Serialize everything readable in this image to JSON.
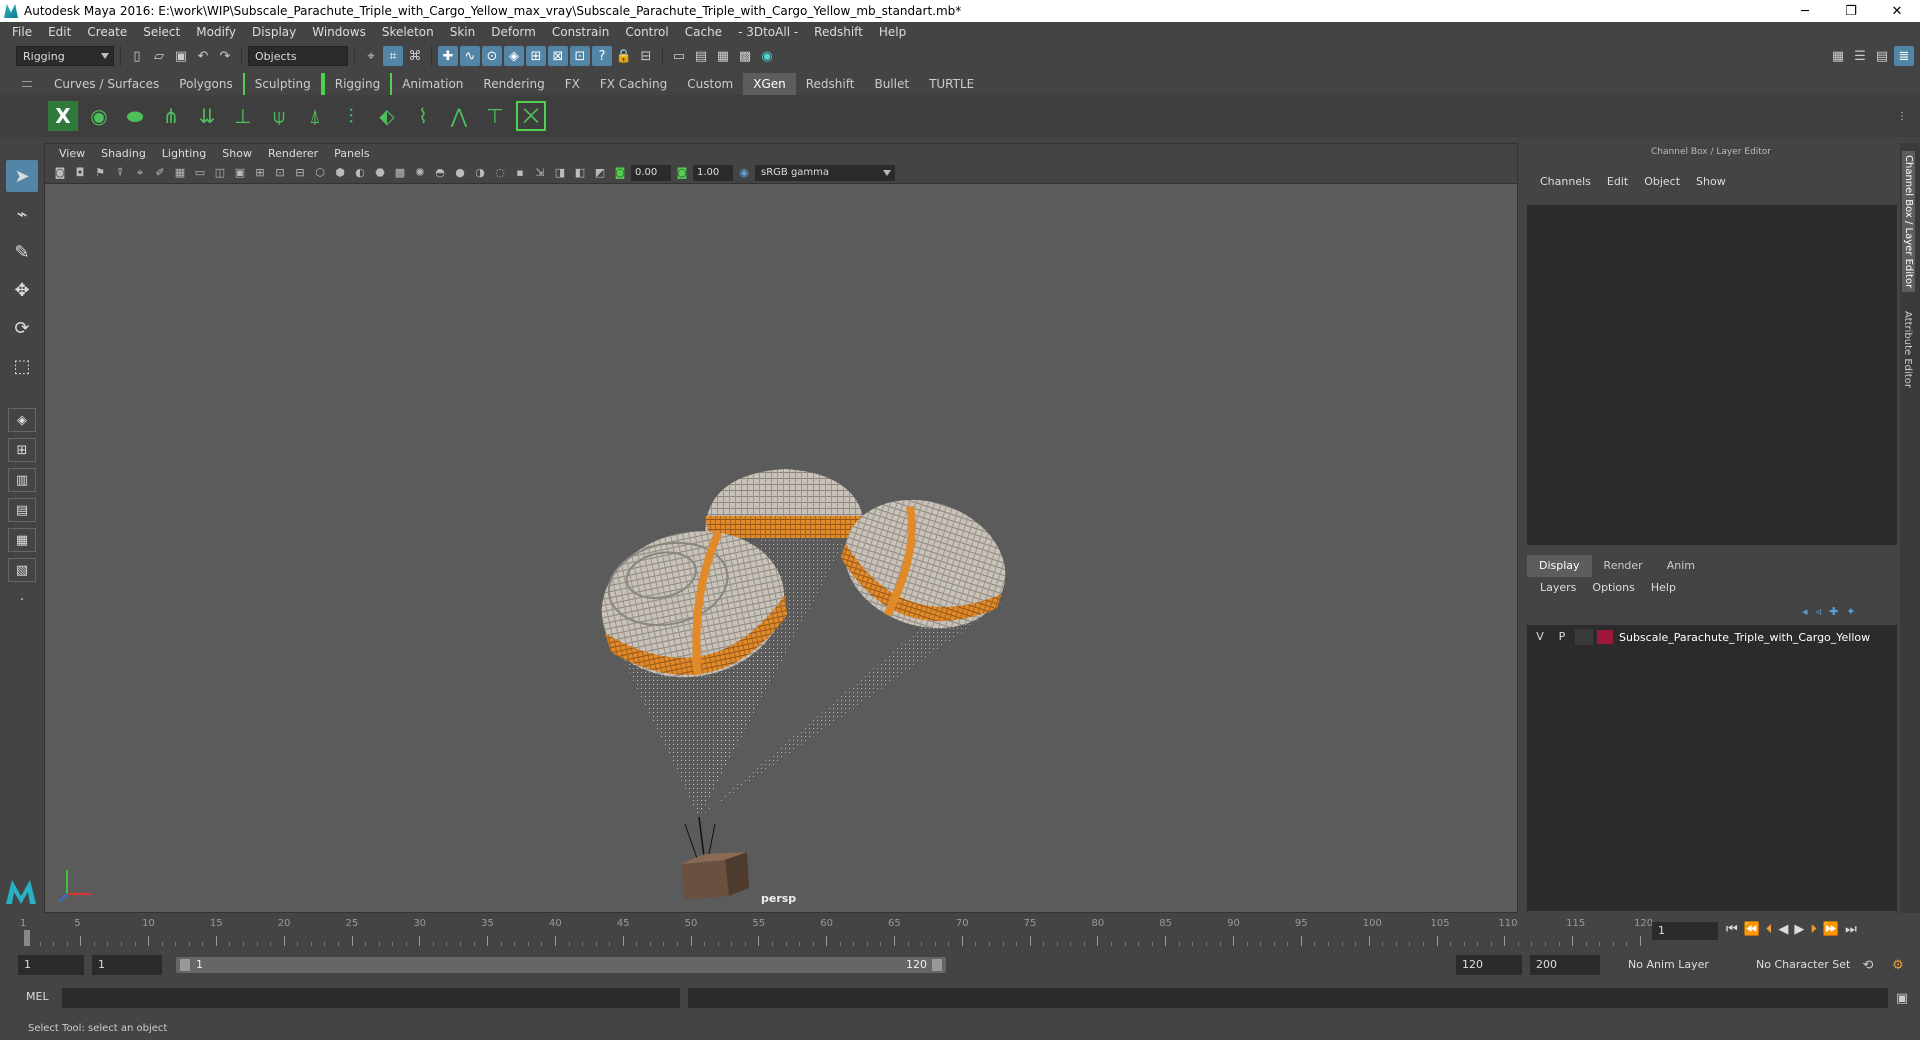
{
  "window": {
    "title": "Autodesk Maya 2016: E:\\work\\WIP\\Subscale_Parachute_Triple_with_Cargo_Yellow_max_vray\\Subscale_Parachute_Triple_with_Cargo_Yellow_mb_standart.mb*",
    "minimize": "─",
    "restore": "❐",
    "close": "✕"
  },
  "menubar": [
    "File",
    "Edit",
    "Create",
    "Select",
    "Modify",
    "Display",
    "Windows",
    "Skeleton",
    "Skin",
    "Deform",
    "Constrain",
    "Control",
    "Cache",
    "- 3DtoAll -",
    "Redshift",
    "Help"
  ],
  "statusline": {
    "menuset": "Rigging",
    "selection_mode": "Objects"
  },
  "shelf_tabs": [
    "Curves / Surfaces",
    "Polygons",
    "Sculpting",
    "Rigging",
    "Animation",
    "Rendering",
    "FX",
    "FX Caching",
    "Custom",
    "XGen",
    "Redshift",
    "Bullet",
    "TURTLE"
  ],
  "shelf_active": "XGen",
  "viewport": {
    "menu": [
      "View",
      "Shading",
      "Lighting",
      "Show",
      "Renderer",
      "Panels"
    ],
    "exposure": "0.00",
    "gamma": "1.00",
    "color_space": "sRGB gamma",
    "camera": "persp"
  },
  "channel_box": {
    "title": "Channel Box / Layer Editor",
    "menu": [
      "Channels",
      "Edit",
      "Object",
      "Show"
    ]
  },
  "layer_editor": {
    "tabs": [
      "Display",
      "Render",
      "Anim"
    ],
    "menu": [
      "Layers",
      "Options",
      "Help"
    ],
    "layer": {
      "v": "V",
      "p": "P",
      "name": "Subscale_Parachute_Triple_with_Cargo_Yellow",
      "color": "#a0173c"
    }
  },
  "side_tabs": [
    "Channel Box / Layer Editor",
    "Attribute Editor"
  ],
  "timeline": {
    "ticks": [
      "1",
      "5",
      "10",
      "15",
      "20",
      "25",
      "30",
      "35",
      "40",
      "45",
      "50",
      "55",
      "60",
      "65",
      "70",
      "75",
      "80",
      "85",
      "90",
      "95",
      "100",
      "105",
      "110",
      "115",
      "120"
    ],
    "current_frame": "1"
  },
  "range": {
    "start": "1",
    "playback_start": "1",
    "bar_start": "1",
    "bar_end": "120",
    "playback_end": "120",
    "end": "200",
    "anim_layer": "No Anim Layer",
    "character_set": "No Character Set"
  },
  "command_line": {
    "label": "MEL"
  },
  "help_line": "Select Tool: select an object"
}
